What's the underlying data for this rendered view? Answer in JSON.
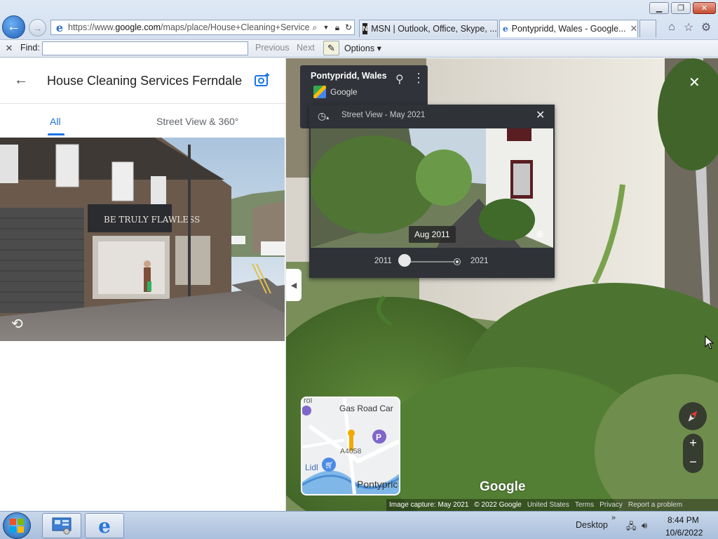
{
  "browser": {
    "address_url_prefix": "https://www.",
    "address_url_host": "google.com",
    "address_url_path": "/maps/place/House+Cleaning+Service",
    "tabs": [
      {
        "label": "MSN | Outlook, Office, Skype, ...",
        "active": false
      },
      {
        "label": "Pontypridd, Wales - Google...",
        "active": true
      }
    ],
    "find": {
      "label": "Find:",
      "value": "",
      "previous": "Previous",
      "next": "Next",
      "options": "Options"
    }
  },
  "left_panel": {
    "title": "House Cleaning Services Ferndale",
    "tabs": {
      "all": "All",
      "street_view": "Street View & 360°"
    }
  },
  "street_view": {
    "location_name": "Pontypridd, Wales",
    "provider": "Google",
    "time_machine": {
      "label": "Street View - May 2021",
      "selected_date": "Aug 2011",
      "year_start": "2011",
      "year_end": "2021",
      "slider_position": 0
    },
    "minimap": {
      "road_label": "Gas Road Car",
      "road_code": "A4058",
      "place_lidl": "Lidl",
      "place_town": "Pontypric",
      "place_top": "rol"
    },
    "logo": "Google",
    "footer": {
      "capture": "Image capture: May 2021",
      "copyright": "© 2022 Google",
      "country": "United States",
      "terms": "Terms",
      "privacy": "Privacy",
      "report": "Report a problem"
    }
  },
  "taskbar": {
    "desktop": "Desktop",
    "time": "8:44 PM",
    "date": "10/6/2022"
  },
  "colors": {
    "accent": "#1a73e8",
    "panel_dark": "#2f3237"
  }
}
